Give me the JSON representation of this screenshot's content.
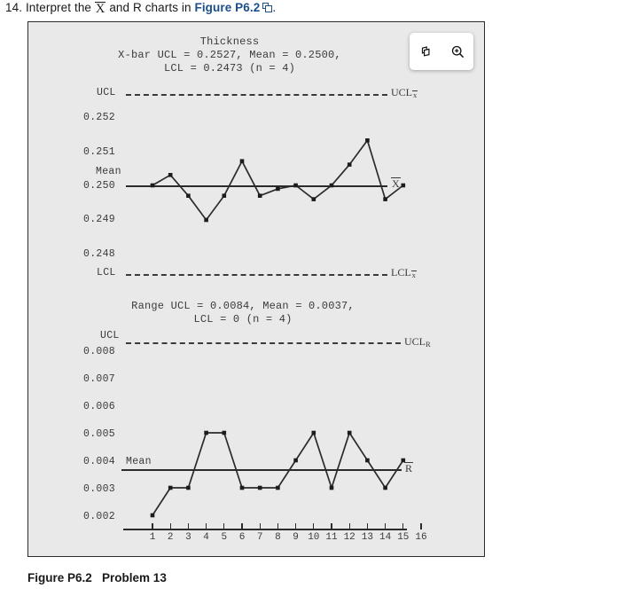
{
  "question": {
    "number": "14.",
    "text_before": "Interpret the",
    "xbar_symbol": "X",
    "text_middle": "and R charts in",
    "link_label": "Figure P6.2",
    "text_after": ".",
    "popout_icon": "open-in-new-window-icon"
  },
  "toolbar": {
    "copy_icon": "copy-pages-icon",
    "zoom_icon": "zoom-in-icon"
  },
  "caption": {
    "figure_label": "Figure P6.2",
    "problem_label": "Problem 13"
  },
  "xbar_chart": {
    "title": "Thickness",
    "params_line1": "X-bar UCL = 0.2527, Mean = 0.2500,",
    "params_line2": "LCL = 0.2473 (n = 4)",
    "ucl_label": "UCL",
    "lcl_label": "LCL",
    "mean_label": "Mean",
    "ucl_right_label": "UCL",
    "ucl_right_sub": "x",
    "lcl_right_label": "LCL",
    "lcl_right_sub": "x",
    "series_label": "X",
    "y_ticks": [
      "0.252",
      "0.251",
      "0.250",
      "0.249",
      "0.248"
    ]
  },
  "range_chart": {
    "params_line1": "Range UCL = 0.0084, Mean = 0.0037,",
    "params_line2": "LCL = 0 (n = 4)",
    "ucl_label": "UCL",
    "mean_label": "Mean",
    "ucl_right_label": "UCL",
    "ucl_right_sub": "R",
    "series_label": "R",
    "y_ticks": [
      "0.008",
      "0.007",
      "0.006",
      "0.005",
      "0.004",
      "0.003",
      "0.002"
    ],
    "x_ticks": [
      "1",
      "2",
      "3",
      "4",
      "5",
      "6",
      "7",
      "8",
      "9",
      "10",
      "11",
      "12",
      "13",
      "14",
      "15",
      "16"
    ]
  },
  "chart_data": [
    {
      "type": "line",
      "title": "Thickness",
      "subtitle": "X-bar UCL = 0.2527, Mean = 0.2500, LCL = 0.2473 (n = 4)",
      "xlabel": "",
      "ylabel": "",
      "x": [
        1,
        2,
        3,
        4,
        5,
        6,
        7,
        8,
        9,
        10,
        11,
        12,
        13,
        14,
        15
      ],
      "values": [
        0.25,
        0.2503,
        0.2497,
        0.249,
        0.2497,
        0.2507,
        0.2497,
        0.2499,
        0.25,
        0.2496,
        0.25,
        0.2506,
        0.2513,
        0.2496,
        0.25
      ],
      "ylim": [
        0.2473,
        0.2527
      ],
      "xlim": [
        1,
        16
      ],
      "grid": false,
      "mean": 0.25,
      "ucl": 0.2527,
      "lcl": 0.2473,
      "ytick_values": [
        0.252,
        0.251,
        0.25,
        0.249,
        0.248
      ],
      "ytick_labels": [
        "0.252",
        "0.251",
        "0.250",
        "0.249",
        "0.248"
      ],
      "annotations": [
        "UCL",
        "LCL",
        "Mean",
        "UCLx",
        "LCLx",
        "X"
      ],
      "marker": "square",
      "series_name": "X-bar"
    },
    {
      "type": "line",
      "title": "Range",
      "subtitle": "Range UCL = 0.0084, Mean = 0.0037, LCL = 0 (n = 4)",
      "xlabel": "",
      "ylabel": "",
      "x": [
        1,
        2,
        3,
        4,
        5,
        6,
        7,
        8,
        9,
        10,
        11,
        12,
        13,
        14,
        15
      ],
      "values": [
        0.002,
        0.003,
        0.003,
        0.005,
        0.005,
        0.003,
        0.003,
        0.003,
        0.004,
        0.005,
        0.003,
        0.005,
        0.004,
        0.003,
        0.004
      ],
      "ylim": [
        0.002,
        0.0084
      ],
      "xlim": [
        1,
        16
      ],
      "grid": false,
      "mean": 0.0037,
      "ucl": 0.0084,
      "lcl": 0,
      "ytick_values": [
        0.008,
        0.007,
        0.006,
        0.005,
        0.004,
        0.003,
        0.002
      ],
      "ytick_labels": [
        "0.008",
        "0.007",
        "0.006",
        "0.005",
        "0.004",
        "0.003",
        "0.002"
      ],
      "xtick_labels": [
        "1",
        "2",
        "3",
        "4",
        "5",
        "6",
        "7",
        "8",
        "9",
        "10",
        "11",
        "12",
        "13",
        "14",
        "15",
        "16"
      ],
      "annotations": [
        "UCL",
        "Mean",
        "UCLR",
        "R"
      ],
      "marker": "square",
      "series_name": "Range"
    }
  ]
}
